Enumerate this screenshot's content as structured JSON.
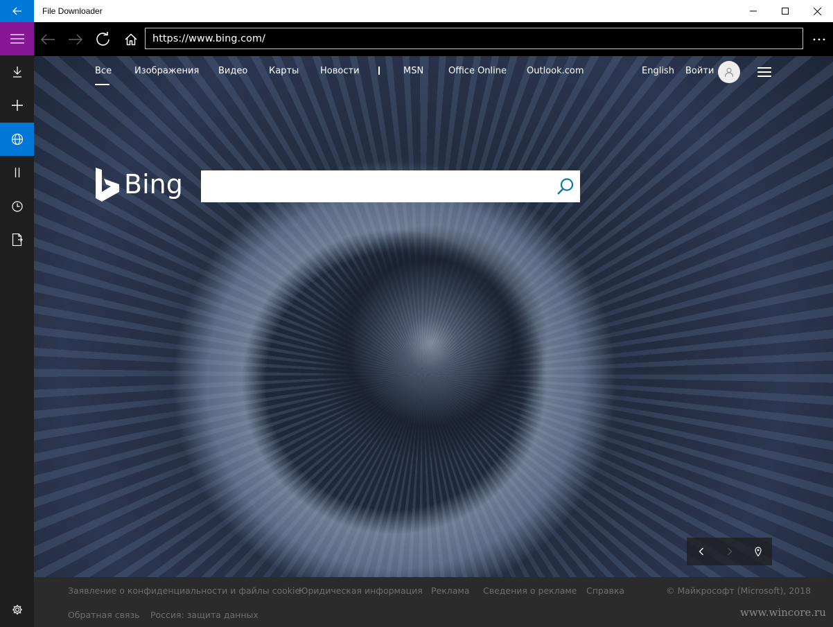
{
  "window": {
    "title": "File Downloader",
    "back_icon": "arrow-left-icon",
    "controls": [
      "minimize-icon",
      "maximize-icon",
      "close-icon"
    ]
  },
  "rail": {
    "items": [
      {
        "icon": "hamburger-menu-icon",
        "color": "#881798"
      },
      {
        "icon": "download-icon"
      },
      {
        "icon": "add-icon"
      },
      {
        "icon": "globe-icon",
        "color": "#0078d7"
      },
      {
        "icon": "pause-icon"
      },
      {
        "icon": "clock-icon"
      },
      {
        "icon": "export-file-icon"
      },
      {
        "icon": "gear-icon"
      }
    ]
  },
  "toolbar": {
    "url": "https://www.bing.com/",
    "buttons": [
      "back-icon",
      "forward-icon",
      "refresh-icon",
      "home-icon",
      "more-icon"
    ]
  },
  "bing": {
    "nav": {
      "items": [
        "Все",
        "Изображения",
        "Видео",
        "Карты",
        "Новости",
        "MSN",
        "Office Online",
        "Outlook.com"
      ],
      "separator": "|",
      "language": "English",
      "signin": "Войти"
    },
    "logo_text": "Bing",
    "search": {
      "placeholder": ""
    }
  },
  "footer": {
    "row1": [
      "Заявление о конфиденциальности и файлы cookie",
      "Юридическая информация",
      "Реклама",
      "Сведения о рекламе",
      "Справка"
    ],
    "row2": [
      "Обратная связь",
      "Россия: защита данных"
    ],
    "copyright": "© Майкрософт (Microsoft), 2018",
    "watermark": "www.wincore.ru"
  }
}
